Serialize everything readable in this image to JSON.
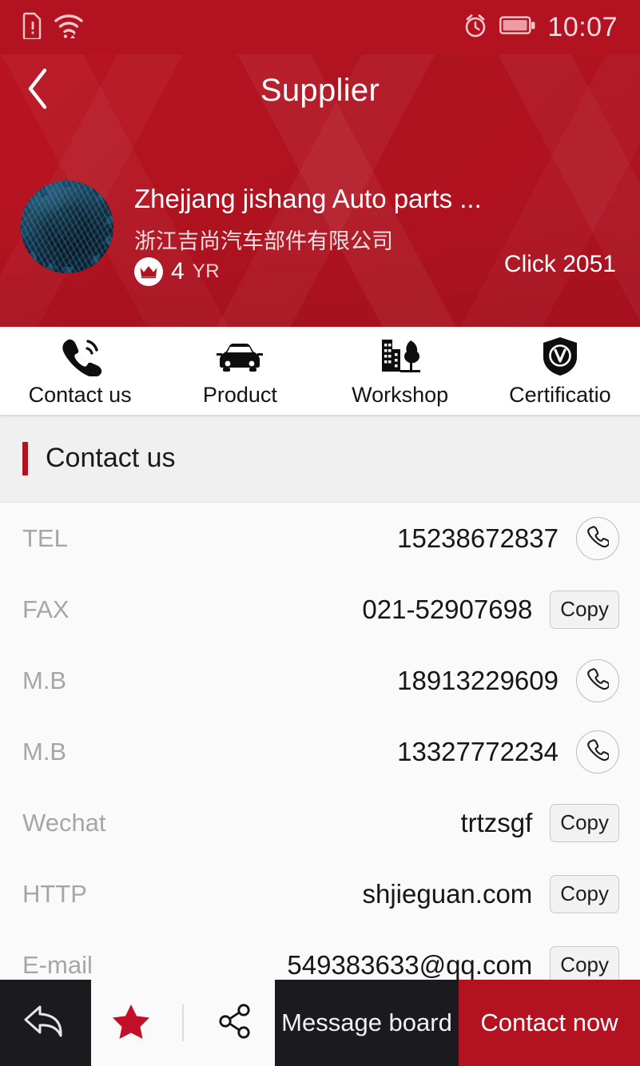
{
  "status_bar": {
    "time": "10:07",
    "icons": [
      "sim-alert-icon",
      "wifi-icon",
      "alarm-icon",
      "battery-icon"
    ]
  },
  "header": {
    "title": "Supplier",
    "back_icon": "chevron-left-icon",
    "accent_color": "#b31320"
  },
  "company": {
    "logo_alt": "company-logo",
    "name_en": "Zhejjang jishang Auto parts ...",
    "name_cn": "浙江吉尚汽车部件有限公司",
    "badge_icon": "crown-icon",
    "years": "4",
    "years_unit": "YR",
    "clicks": "Click 2051"
  },
  "tabs": [
    {
      "label": "Contact us",
      "icon": "phone-ring-icon"
    },
    {
      "label": "Product",
      "icon": "car-icon"
    },
    {
      "label": "Workshop",
      "icon": "factory-tree-icon"
    },
    {
      "label": "Certificatio",
      "icon": "shield-v-icon"
    }
  ],
  "section": {
    "title": "Contact us"
  },
  "contacts": [
    {
      "label": "TEL",
      "value": "15238672837",
      "action": "call",
      "action_label": "",
      "action_icon": "phone-icon"
    },
    {
      "label": "FAX",
      "value": "021-52907698",
      "action": "copy",
      "action_label": "Copy",
      "action_icon": ""
    },
    {
      "label": "M.B",
      "value": "18913229609",
      "action": "call",
      "action_label": "",
      "action_icon": "phone-icon"
    },
    {
      "label": "M.B",
      "value": "13327772234",
      "action": "call",
      "action_label": "",
      "action_icon": "phone-icon"
    },
    {
      "label": "Wechat",
      "value": "trtzsgf",
      "action": "copy",
      "action_label": "Copy",
      "action_icon": ""
    },
    {
      "label": "HTTP",
      "value": "shjieguan.com",
      "action": "copy",
      "action_label": "Copy",
      "action_icon": ""
    },
    {
      "label": "E-mail",
      "value": "549383633@qq.com",
      "action": "copy",
      "action_label": "Copy",
      "action_icon": ""
    }
  ],
  "bottom_bar": {
    "back_icon": "reply-arrow-icon",
    "favorite_icon": "star-icon",
    "favorite_color": "#c3102a",
    "share_icon": "share-icon",
    "message_label": "Message board",
    "contact_label": "Contact now"
  }
}
